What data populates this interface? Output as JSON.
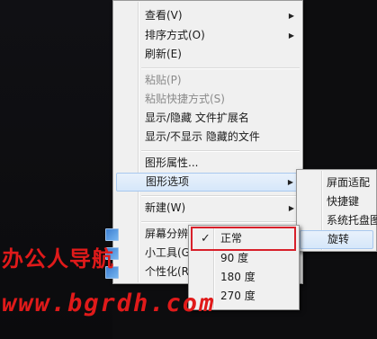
{
  "main_menu": {
    "items": [
      {
        "label": "查看(V)",
        "submenu": true
      },
      {
        "label": "排序方式(O)",
        "submenu": true
      },
      {
        "label": "刷新(E)"
      },
      {
        "label": "粘贴(P)",
        "disabled": true
      },
      {
        "label": "粘贴快捷方式(S)",
        "disabled": true
      },
      {
        "label": "显示/隐藏 文件扩展名"
      },
      {
        "label": "显示/不显示 隐藏的文件"
      },
      {
        "label": "图形属性..."
      },
      {
        "label": "图形选项",
        "submenu": true,
        "highlighted": true
      },
      {
        "label": "新建(W)",
        "submenu": true
      },
      {
        "label": "屏幕分辨率"
      },
      {
        "label": "小工具(G)"
      },
      {
        "label": "个性化(R)"
      }
    ]
  },
  "graphics_submenu": {
    "items": [
      {
        "label": "屏面适配"
      },
      {
        "label": "快捷键"
      },
      {
        "label": "系统托盘图"
      },
      {
        "label": "旋转",
        "highlighted": true
      }
    ]
  },
  "rotation_submenu": {
    "items": [
      {
        "label": "正常",
        "checked": true
      },
      {
        "label": "90 度"
      },
      {
        "label": "180 度"
      },
      {
        "label": "270 度"
      }
    ],
    "check_glyph": "✓"
  },
  "watermark": {
    "line1": "办公人导航",
    "line2": "www.bgrdh.com",
    "color": "#e01a1a"
  },
  "icons": {
    "submenu_arrow": "▶"
  }
}
